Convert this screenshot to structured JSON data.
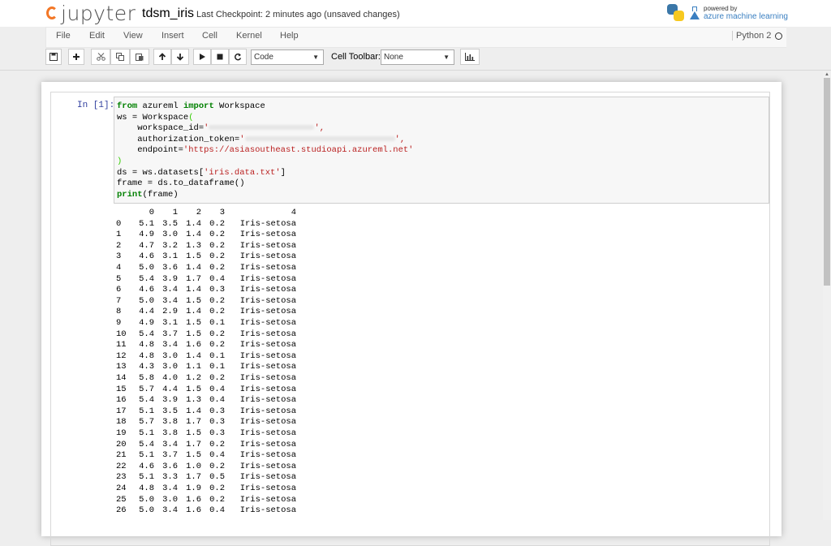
{
  "header": {
    "logo_text": "jupyter",
    "notebook_name": "tdsm_iris",
    "checkpoint": "Last Checkpoint: 2 minutes ago (unsaved changes)",
    "powered_by": "powered by",
    "brand": "azure machine learning"
  },
  "menu": {
    "items": [
      "File",
      "Edit",
      "View",
      "Insert",
      "Cell",
      "Kernel",
      "Help"
    ],
    "kernel_name": "Python 2"
  },
  "toolbar": {
    "icons": [
      "save-icon",
      "plus-icon",
      "cut-icon",
      "copy-icon",
      "paste-icon",
      "arrow-up-icon",
      "arrow-down-icon",
      "run-icon",
      "stop-icon",
      "restart-icon"
    ],
    "cell_type": "Code",
    "cell_toolbar_label": "Cell Toolbar:",
    "cell_toolbar_value": "None"
  },
  "cell": {
    "prompt": "In [1]:",
    "code": {
      "l1_kw1": "from",
      "l1_mod": " azureml ",
      "l1_kw2": "import",
      "l1_name": " Workspace",
      "l2": "ws = Workspace",
      "l2_paren": "(",
      "l3_key": "    workspace_id=",
      "l3_q1": "'",
      "l3_q2": "',",
      "l4_key": "    authorization_token=",
      "l4_q1": "'",
      "l4_q2": "',",
      "l5_key": "    endpoint=",
      "l5_str": "'https://asiasoutheast.studioapi.azureml.net'",
      "l6_paren": ")",
      "l7_pre": "ds = ws.datasets[",
      "l7_str": "'iris.data.txt'",
      "l7_post": "]",
      "l8": "frame = ds.to_dataframe()",
      "l9_kw": "print",
      "l9_rest": "(frame)"
    }
  },
  "output": {
    "headers": [
      "0",
      "1",
      "2",
      "3",
      "4"
    ],
    "rows": [
      [
        "0",
        "5.1",
        "3.5",
        "1.4",
        "0.2",
        "Iris-setosa"
      ],
      [
        "1",
        "4.9",
        "3.0",
        "1.4",
        "0.2",
        "Iris-setosa"
      ],
      [
        "2",
        "4.7",
        "3.2",
        "1.3",
        "0.2",
        "Iris-setosa"
      ],
      [
        "3",
        "4.6",
        "3.1",
        "1.5",
        "0.2",
        "Iris-setosa"
      ],
      [
        "4",
        "5.0",
        "3.6",
        "1.4",
        "0.2",
        "Iris-setosa"
      ],
      [
        "5",
        "5.4",
        "3.9",
        "1.7",
        "0.4",
        "Iris-setosa"
      ],
      [
        "6",
        "4.6",
        "3.4",
        "1.4",
        "0.3",
        "Iris-setosa"
      ],
      [
        "7",
        "5.0",
        "3.4",
        "1.5",
        "0.2",
        "Iris-setosa"
      ],
      [
        "8",
        "4.4",
        "2.9",
        "1.4",
        "0.2",
        "Iris-setosa"
      ],
      [
        "9",
        "4.9",
        "3.1",
        "1.5",
        "0.1",
        "Iris-setosa"
      ],
      [
        "10",
        "5.4",
        "3.7",
        "1.5",
        "0.2",
        "Iris-setosa"
      ],
      [
        "11",
        "4.8",
        "3.4",
        "1.6",
        "0.2",
        "Iris-setosa"
      ],
      [
        "12",
        "4.8",
        "3.0",
        "1.4",
        "0.1",
        "Iris-setosa"
      ],
      [
        "13",
        "4.3",
        "3.0",
        "1.1",
        "0.1",
        "Iris-setosa"
      ],
      [
        "14",
        "5.8",
        "4.0",
        "1.2",
        "0.2",
        "Iris-setosa"
      ],
      [
        "15",
        "5.7",
        "4.4",
        "1.5",
        "0.4",
        "Iris-setosa"
      ],
      [
        "16",
        "5.4",
        "3.9",
        "1.3",
        "0.4",
        "Iris-setosa"
      ],
      [
        "17",
        "5.1",
        "3.5",
        "1.4",
        "0.3",
        "Iris-setosa"
      ],
      [
        "18",
        "5.7",
        "3.8",
        "1.7",
        "0.3",
        "Iris-setosa"
      ],
      [
        "19",
        "5.1",
        "3.8",
        "1.5",
        "0.3",
        "Iris-setosa"
      ],
      [
        "20",
        "5.4",
        "3.4",
        "1.7",
        "0.2",
        "Iris-setosa"
      ],
      [
        "21",
        "5.1",
        "3.7",
        "1.5",
        "0.4",
        "Iris-setosa"
      ],
      [
        "22",
        "4.6",
        "3.6",
        "1.0",
        "0.2",
        "Iris-setosa"
      ],
      [
        "23",
        "5.1",
        "3.3",
        "1.7",
        "0.5",
        "Iris-setosa"
      ],
      [
        "24",
        "4.8",
        "3.4",
        "1.9",
        "0.2",
        "Iris-setosa"
      ],
      [
        "25",
        "5.0",
        "3.0",
        "1.6",
        "0.2",
        "Iris-setosa"
      ],
      [
        "26",
        "5.0",
        "3.4",
        "1.6",
        "0.4",
        "Iris-setosa"
      ]
    ]
  }
}
